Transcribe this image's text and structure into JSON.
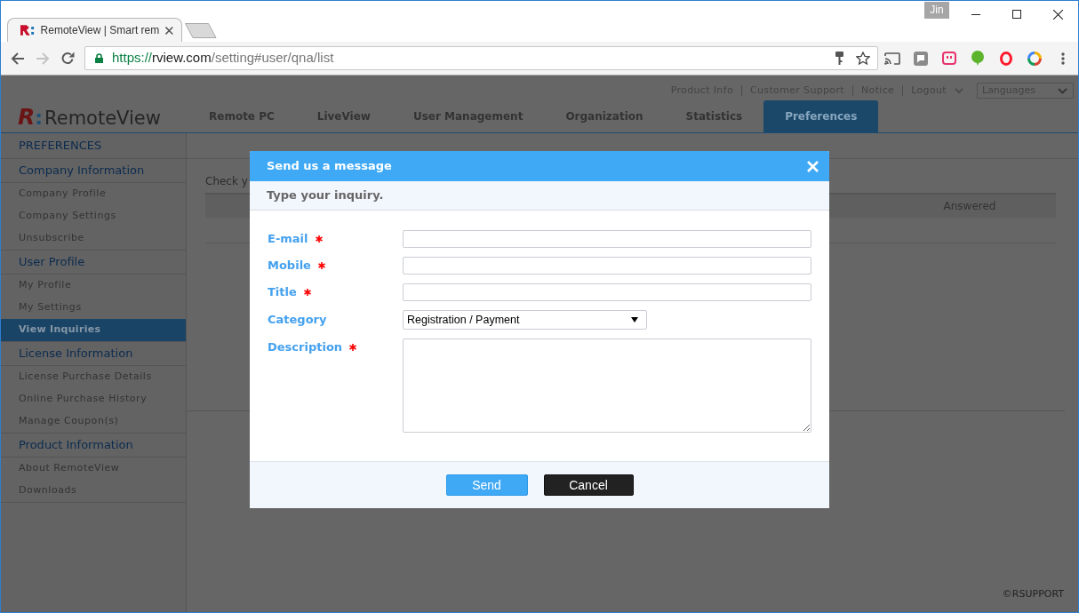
{
  "browser": {
    "tabs": [
      {
        "title": "RemoteView | Smart rem",
        "selected": true
      }
    ],
    "profile": "Jin",
    "back_disabled": false,
    "forward_disabled": true,
    "url": {
      "scheme": "https://",
      "host": "rview.com",
      "path": "/setting#user/qna/list"
    }
  },
  "header": {
    "links": [
      {
        "label": "Product Info",
        "dropdown": false
      },
      {
        "label": "Customer Support",
        "dropdown": false
      },
      {
        "label": "Notice",
        "dropdown": false
      },
      {
        "label": "Logout",
        "dropdown": true
      }
    ],
    "language": "Languages",
    "logo": {
      "mark": "R",
      "separator": ":",
      "name": "RemoteView"
    },
    "tabs": [
      {
        "label": "Remote PC",
        "selected": false
      },
      {
        "label": "LiveView",
        "selected": false
      },
      {
        "label": "User Management",
        "selected": false
      },
      {
        "label": "Organization",
        "selected": false
      },
      {
        "label": "Statistics",
        "selected": false
      },
      {
        "label": "Preferences",
        "selected": true
      }
    ]
  },
  "sidebar": {
    "title": "PREFERENCES",
    "sections": [
      {
        "heading": "Company Information",
        "items": [
          {
            "label": "Company Profile",
            "selected": false
          },
          {
            "label": "Company Settings",
            "selected": false
          },
          {
            "label": "Unsubscribe",
            "selected": false
          }
        ]
      },
      {
        "heading": "User Profile",
        "items": [
          {
            "label": "My Profile",
            "selected": false
          },
          {
            "label": "My Settings",
            "selected": false
          },
          {
            "label": "View Inquiries",
            "selected": true
          }
        ]
      },
      {
        "heading": "License Information",
        "items": [
          {
            "label": "License Purchase Details",
            "selected": false
          },
          {
            "label": "Online Purchase History",
            "selected": false
          },
          {
            "label": "Manage Coupon(s)",
            "selected": false
          }
        ]
      },
      {
        "heading": "Product Information",
        "items": [
          {
            "label": "About RemoteView",
            "selected": false
          },
          {
            "label": "Downloads",
            "selected": false
          }
        ]
      }
    ]
  },
  "content": {
    "intro": "Check y",
    "columns": [
      "Answered"
    ]
  },
  "dialog": {
    "title": "Send us a message",
    "subtitle": "Type your inquiry.",
    "fields": [
      {
        "kind": "text",
        "label": "E-mail",
        "required": true
      },
      {
        "kind": "text",
        "label": "Mobile",
        "required": true
      },
      {
        "kind": "text",
        "label": "Title",
        "required": true
      },
      {
        "kind": "select",
        "label": "Category",
        "required": false,
        "value": "Registration / Payment"
      },
      {
        "kind": "textarea",
        "label": "Description",
        "required": true
      }
    ],
    "buttons": [
      {
        "label": "Send",
        "kind": "submit"
      },
      {
        "label": "Cancel",
        "kind": "cancel"
      }
    ]
  },
  "footer": {
    "copyright": "©RSUPPORT"
  }
}
